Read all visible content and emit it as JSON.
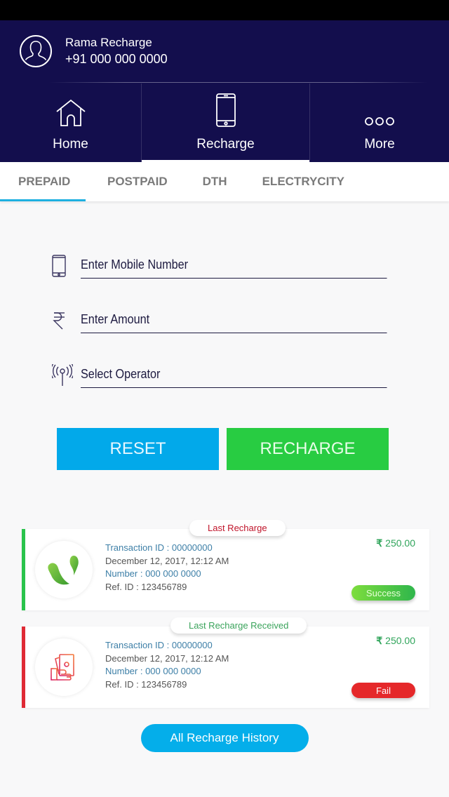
{
  "header": {
    "user_name": "Rama Recharge",
    "user_phone": "+91 000 000 0000"
  },
  "nav": {
    "items": [
      {
        "label": "Home",
        "icon": "home-icon"
      },
      {
        "label": "Recharge",
        "icon": "mobile-phone-icon",
        "active": true
      },
      {
        "label": "More",
        "icon": "more-dots-icon"
      }
    ]
  },
  "tabs": [
    {
      "label": "PREPAID",
      "active": true
    },
    {
      "label": "POSTPAID"
    },
    {
      "label": "DTH"
    },
    {
      "label": "ELECTRYCITY"
    }
  ],
  "form": {
    "mobile_placeholder": "Enter Mobile Number",
    "amount_placeholder": "Enter Amount",
    "operator_placeholder": "Select Operator",
    "reset_label": "RESET",
    "recharge_label": "RECHARGE"
  },
  "cards": [
    {
      "badge": "Last Recharge",
      "transaction": "Transaction ID : 00000000",
      "date": "December 12, 2017, 12:12 AM",
      "number": "Number : 000 000 0000",
      "ref": "Ref. ID : 123456789",
      "currency": "₹",
      "amount": "250.00",
      "status": "Success",
      "status_color": "#2fb64c",
      "icon": "operator-logo-icon"
    },
    {
      "badge": "Last Recharge Received",
      "transaction": "Transaction ID : 00000000",
      "date": "December 12, 2017, 12:12 AM",
      "number": "Number : 000 000 0000",
      "ref": "Ref. ID : 123456789",
      "currency": "₹",
      "amount": "250.00",
      "status": "Fail",
      "status_color": "#e5282a",
      "icon": "money-hand-icon"
    }
  ],
  "history_label": "All Recharge History",
  "colors": {
    "header_bg": "#130e4d",
    "accent_blue": "#02a9ea",
    "accent_green": "#28cc42",
    "fail_red": "#df2a35"
  }
}
